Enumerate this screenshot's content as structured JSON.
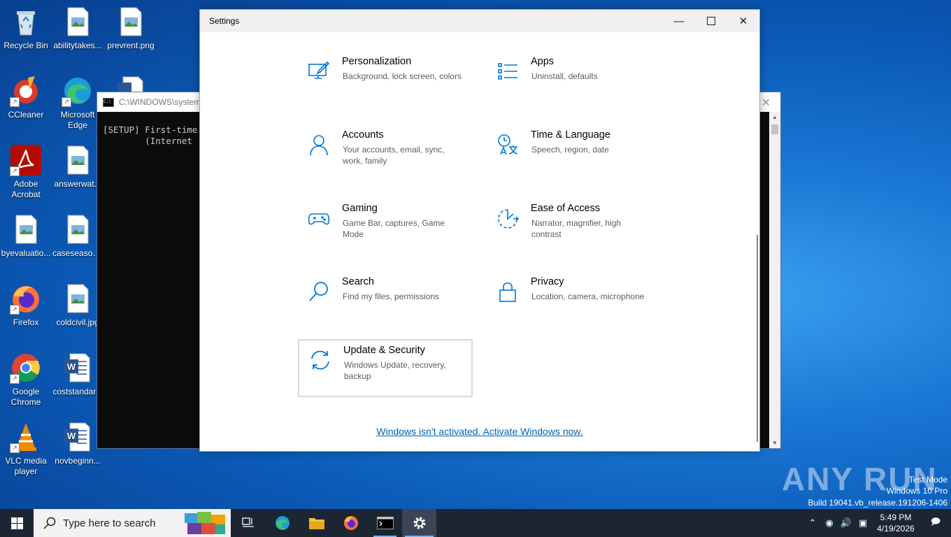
{
  "desktop": {
    "icons": [
      {
        "label": "Recycle Bin",
        "icon": "recycle-bin-icon"
      },
      {
        "label": "abilitytakes...",
        "icon": "image-file-icon"
      },
      {
        "label": "prevrent.png",
        "icon": "image-file-icon"
      },
      {
        "label": "CCleaner",
        "icon": "ccleaner-icon"
      },
      {
        "label": "Microsoft Edge",
        "icon": "edge-icon"
      },
      {
        "label": "Adobe Acrobat",
        "icon": "acrobat-icon"
      },
      {
        "label": "answerwat...",
        "icon": "image-file-icon"
      },
      {
        "label": "byevaluatio...",
        "icon": "image-file-icon"
      },
      {
        "label": "caseseason...",
        "icon": "image-file-icon"
      },
      {
        "label": "Firefox",
        "icon": "firefox-icon"
      },
      {
        "label": "coldcivil.jpg",
        "icon": "image-file-icon"
      },
      {
        "label": "Google Chrome",
        "icon": "chrome-icon"
      },
      {
        "label": "coststandar...",
        "icon": "word-doc-icon"
      },
      {
        "label": "VLC media player",
        "icon": "vlc-icon"
      },
      {
        "label": "novbeginn...",
        "icon": "word-doc-icon"
      }
    ]
  },
  "console": {
    "title": "C:\\WINDOWS\\system32",
    "lines": [
      "[SETUP] First-time",
      "        (Internet"
    ]
  },
  "settings": {
    "title": "Settings",
    "items": [
      {
        "name": "Personalization",
        "desc": "Background, lock screen, colors",
        "icon": "personalization-icon"
      },
      {
        "name": "Apps",
        "desc": "Uninstall, defaults",
        "icon": "apps-icon"
      },
      {
        "name": "Accounts",
        "desc": "Your accounts, email, sync, work, family",
        "icon": "accounts-icon"
      },
      {
        "name": "Time & Language",
        "desc": "Speech, region, date",
        "icon": "time-language-icon"
      },
      {
        "name": "Gaming",
        "desc": "Game Bar, captures, Game Mode",
        "icon": "gaming-icon"
      },
      {
        "name": "Ease of Access",
        "desc": "Narrator, magnifier, high contrast",
        "icon": "ease-of-access-icon"
      },
      {
        "name": "Search",
        "desc": "Find my files, permissions",
        "icon": "search-icon"
      },
      {
        "name": "Privacy",
        "desc": "Location, camera, microphone",
        "icon": "lock-icon"
      },
      {
        "name": "Update & Security",
        "desc": "Windows Update, recovery, backup",
        "icon": "update-icon"
      }
    ],
    "activate_link": "Windows isn't activated. Activate Windows now."
  },
  "watermark": {
    "brand": "ANY RUN",
    "mode": "Test Mode",
    "edition": "Windows 10 Pro",
    "build": "Build 19041.vb_release.191206-1406"
  },
  "taskbar": {
    "search_placeholder": "Type here to search",
    "time": "5:49 PM",
    "date": "4/19/2026"
  },
  "colors": {
    "accent": "#0078d7",
    "taskbar": "#1c2532"
  }
}
